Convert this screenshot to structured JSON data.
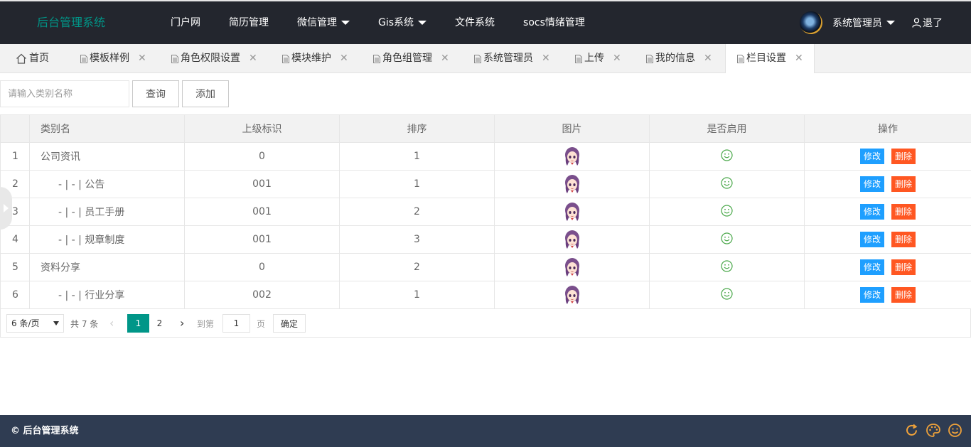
{
  "header": {
    "logo": "后台管理系统",
    "nav": [
      {
        "label": "门户网",
        "dropdown": false
      },
      {
        "label": "简历管理",
        "dropdown": false
      },
      {
        "label": "微信管理",
        "dropdown": true
      },
      {
        "label": "Gis系统",
        "dropdown": true
      },
      {
        "label": "文件系统",
        "dropdown": false
      },
      {
        "label": "socs情绪管理",
        "dropdown": false
      }
    ],
    "user_name": "系统管理员",
    "logout": "退了"
  },
  "tabs": [
    {
      "label": "首页",
      "icon": "home-icon",
      "closable": false
    },
    {
      "label": "模板样例",
      "icon": "file-icon",
      "closable": true
    },
    {
      "label": "角色权限设置",
      "icon": "file-icon",
      "closable": true
    },
    {
      "label": "模块维护",
      "icon": "file-icon",
      "closable": true
    },
    {
      "label": "角色组管理",
      "icon": "file-icon",
      "closable": true
    },
    {
      "label": "系统管理员",
      "icon": "file-icon",
      "closable": true
    },
    {
      "label": "上传",
      "icon": "file-icon",
      "closable": true
    },
    {
      "label": "我的信息",
      "icon": "file-icon",
      "closable": true
    },
    {
      "label": "栏目设置",
      "icon": "file-icon",
      "closable": true,
      "active": true
    }
  ],
  "tab_close": "✕",
  "search": {
    "placeholder": "请输入类别名称",
    "query_label": "查询",
    "add_label": "添加"
  },
  "table": {
    "columns": [
      "",
      "类别名",
      "上级标识",
      "排序",
      "图片",
      "是否启用",
      "操作"
    ],
    "rows": [
      {
        "num": "1",
        "name": "公司资讯",
        "parent": "0",
        "sort": "1",
        "indent": false
      },
      {
        "num": "2",
        "name": "- | - | 公告",
        "parent": "001",
        "sort": "1",
        "indent": true
      },
      {
        "num": "3",
        "name": "- | - | 员工手册",
        "parent": "001",
        "sort": "2",
        "indent": true
      },
      {
        "num": "4",
        "name": "- | - | 规章制度",
        "parent": "001",
        "sort": "3",
        "indent": true
      },
      {
        "num": "5",
        "name": "资料分享",
        "parent": "0",
        "sort": "2",
        "indent": false
      },
      {
        "num": "6",
        "name": "- | - | 行业分享",
        "parent": "002",
        "sort": "1",
        "indent": true
      }
    ],
    "edit_label": "修改",
    "delete_label": "删除"
  },
  "pager": {
    "page_size": "6 条/页",
    "total": "共 7 条",
    "pages": [
      "1",
      "2"
    ],
    "current": "1",
    "goto_label": "到第",
    "goto_value": "1",
    "page_unit": "页",
    "confirm": "确定"
  },
  "footer": {
    "copyright": "© 后台管理系统"
  },
  "colors": {
    "header_bg": "#23262e",
    "accent": "#009688",
    "edit": "#1e9fff",
    "delete": "#ff5722",
    "footer_bg": "#2f3c52",
    "footer_icon": "#f0a23a",
    "smile": "#4aa84a"
  }
}
